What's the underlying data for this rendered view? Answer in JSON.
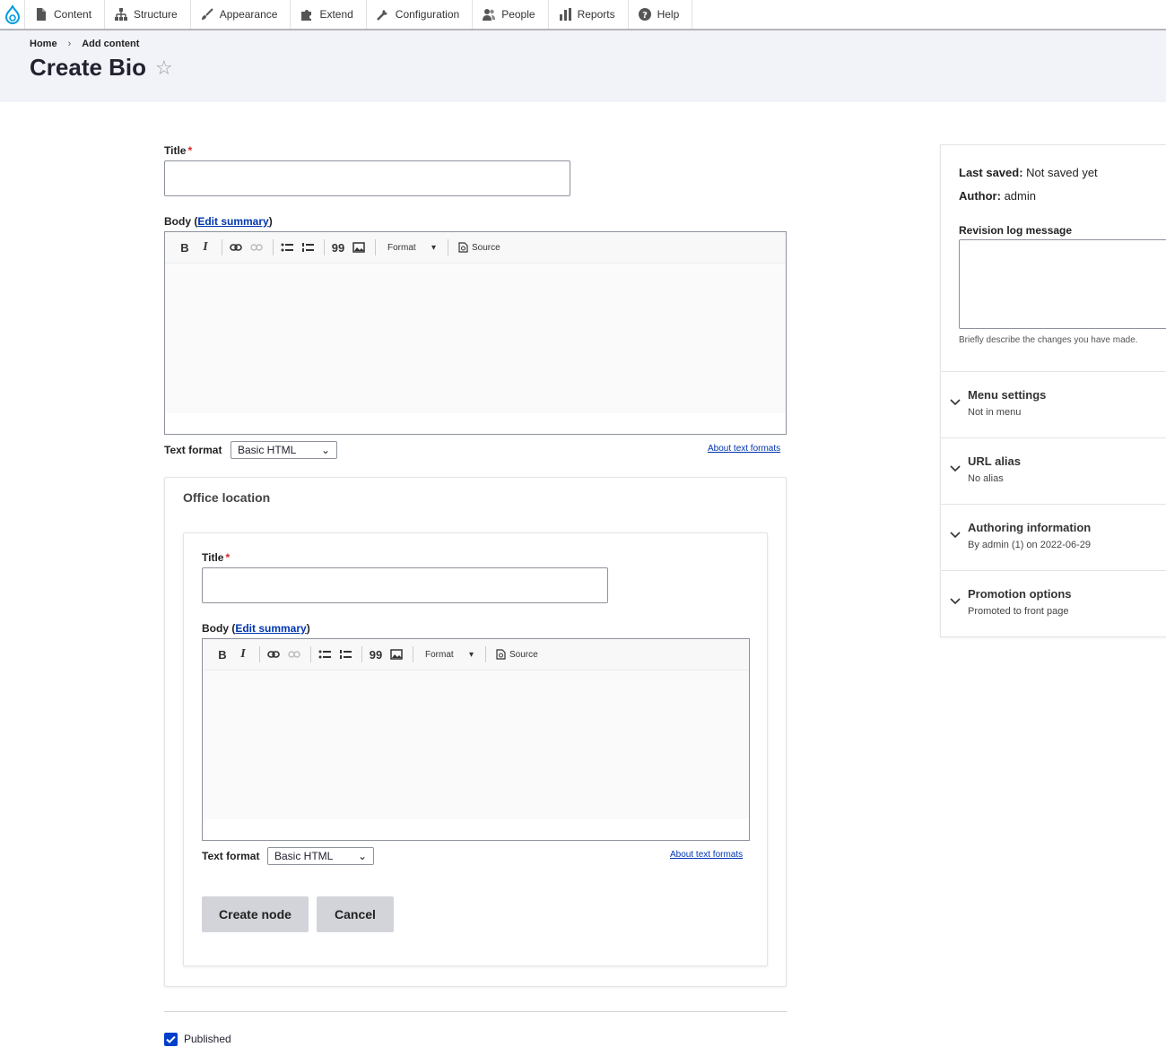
{
  "toolbar": {
    "items": [
      {
        "label": "Content",
        "icon": "file-icon"
      },
      {
        "label": "Structure",
        "icon": "sitemap-icon"
      },
      {
        "label": "Appearance",
        "icon": "paintbrush-icon"
      },
      {
        "label": "Extend",
        "icon": "puzzle-icon"
      },
      {
        "label": "Configuration",
        "icon": "wrench-icon"
      },
      {
        "label": "People",
        "icon": "people-icon"
      },
      {
        "label": "Reports",
        "icon": "bar-chart-icon"
      },
      {
        "label": "Help",
        "icon": "help-icon"
      }
    ]
  },
  "header": {
    "breadcrumb": [
      "Home",
      "Add content"
    ],
    "breadcrumb_sep": "›",
    "title": "Create Bio",
    "star": "☆"
  },
  "form": {
    "title_label": "Title",
    "required_mark": "*",
    "body_label": "Body (",
    "edit_summary": "Edit summary",
    "body_close": ")",
    "editor": {
      "bold": "B",
      "italic": "I",
      "quote": "99",
      "format": "Format",
      "format_arrow": "▾",
      "source": "Source"
    },
    "text_format_label": "Text format",
    "text_format_value": "Basic HTML",
    "select_arrow": "⌄",
    "about_formats": "About text formats"
  },
  "office": {
    "legend": "Office location",
    "title_label": "Title",
    "body_label": "Body (",
    "edit_summary": "Edit summary",
    "body_close": ")",
    "text_format_label": "Text format",
    "text_format_value": "Basic HTML",
    "about_formats": "About text formats",
    "create_button": "Create node",
    "cancel_button": "Cancel"
  },
  "published": {
    "label": "Published",
    "checked": true
  },
  "sidebar": {
    "last_saved_label": "Last saved:",
    "last_saved_value": "Not saved yet",
    "author_label": "Author:",
    "author_value": "admin",
    "revision_label": "Revision log message",
    "revision_value": "",
    "revision_help": "Briefly describe the changes you have made.",
    "sections": [
      {
        "title": "Menu settings",
        "summary": "Not in menu"
      },
      {
        "title": "URL alias",
        "summary": "No alias"
      },
      {
        "title": "Authoring information",
        "summary": "By admin (1) on 2022-06-29"
      },
      {
        "title": "Promotion options",
        "summary": "Promoted to front page"
      }
    ]
  },
  "colors": {
    "accent": "#003ecc",
    "link": "#0036b1",
    "required": "#d72222",
    "header_bg": "#f2f3f8",
    "button_bg": "#d3d4d9"
  }
}
